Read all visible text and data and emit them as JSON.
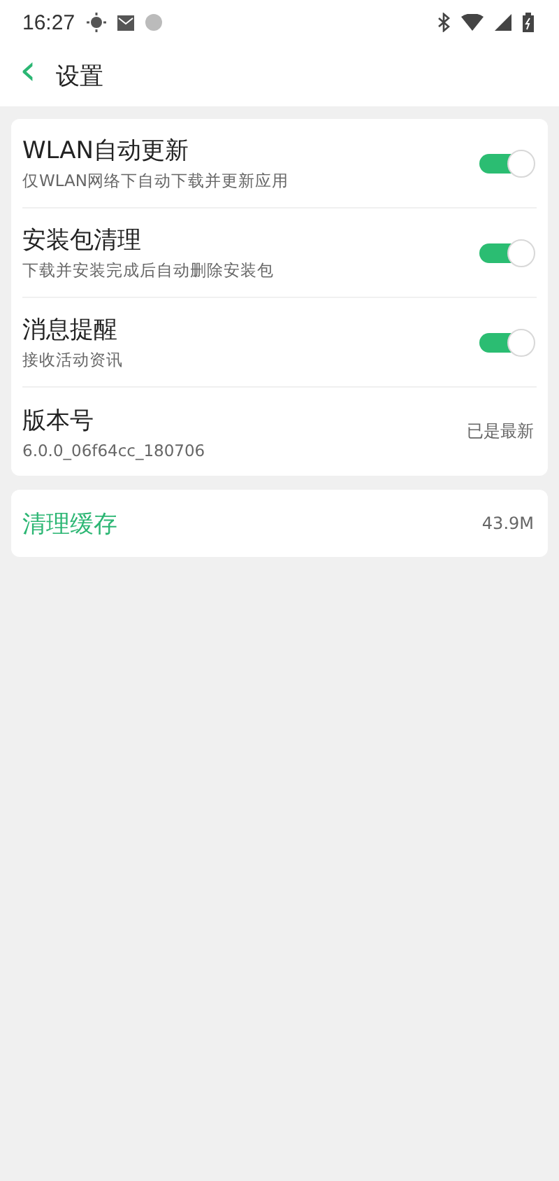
{
  "status_bar": {
    "time": "16:27"
  },
  "header": {
    "back": "‹",
    "title": "设置"
  },
  "settings": [
    {
      "kind": "toggle",
      "title": "WLAN自动更新",
      "subtitle": "仅WLAN网络下自动下载并更新应用",
      "on": true
    },
    {
      "kind": "toggle",
      "title": "安装包清理",
      "subtitle": "下载并安装完成后自动删除安装包",
      "on": true
    },
    {
      "kind": "toggle",
      "title": "消息提醒",
      "subtitle": "接收活动资讯",
      "on": true
    },
    {
      "kind": "info",
      "title": "版本号",
      "subtitle": "6.0.0_06f64cc_180706",
      "value": "已是最新"
    }
  ],
  "cache": {
    "title": "清理缓存",
    "value": "43.9M"
  }
}
